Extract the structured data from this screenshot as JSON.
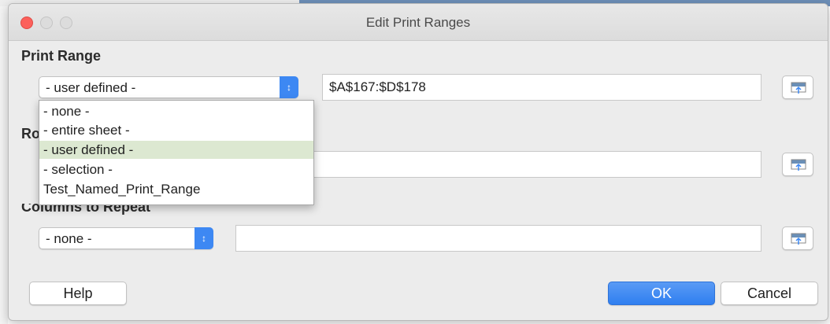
{
  "dialog": {
    "title": "Edit Print Ranges"
  },
  "print_range": {
    "label": "Print Range",
    "selected": "- user defined -",
    "value": "$A$167:$D$178"
  },
  "rows_to_repeat": {
    "label_visible_fragment": "Ro",
    "value": ""
  },
  "columns_to_repeat": {
    "label_visible_fragment": "Columns to Repeat",
    "selected": "- none -",
    "value": ""
  },
  "dropdown_options": [
    "- none -",
    "- entire sheet -",
    "- user defined -",
    "- selection -",
    "Test_Named_Print_Range"
  ],
  "dropdown_selected_index": 2,
  "buttons": {
    "help": "Help",
    "ok": "OK",
    "cancel": "Cancel"
  },
  "icons": {
    "select_arrow": "up-down-chevron-icon",
    "shrink": "shrink-dialog-icon"
  },
  "colors": {
    "accent": "#3d88f3",
    "selection": "#dce8d1",
    "close": "#fc605b"
  }
}
